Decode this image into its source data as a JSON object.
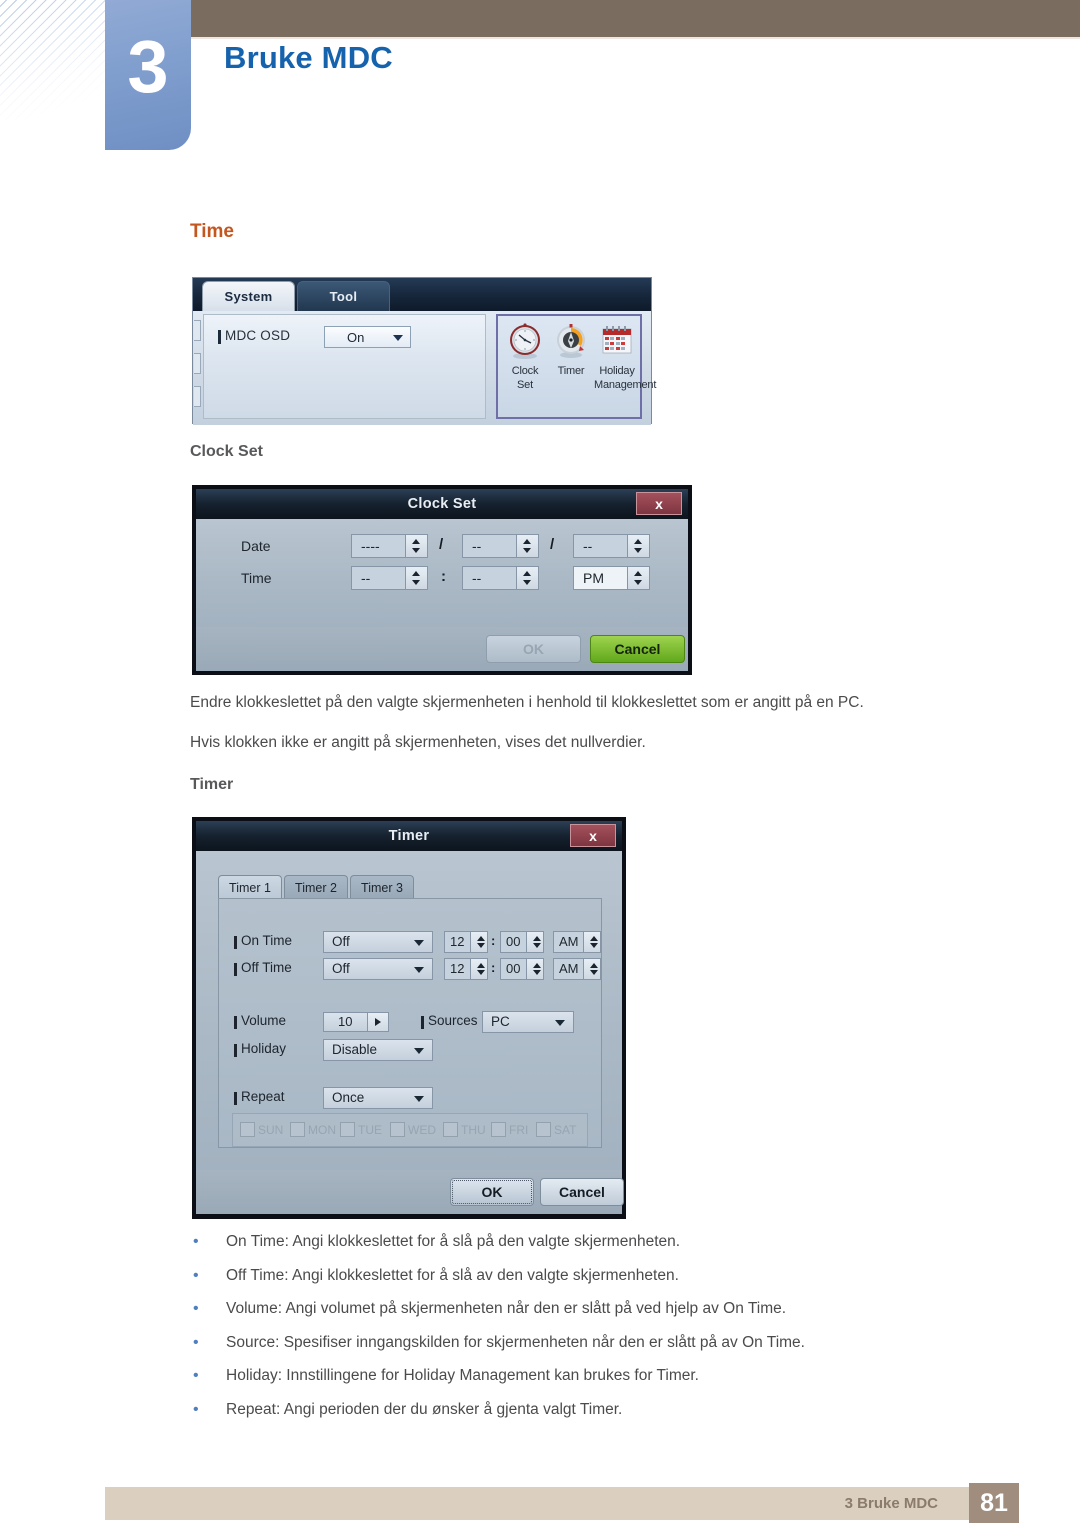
{
  "header": {
    "chapter_number": "3",
    "chapter_title": "Bruke MDC"
  },
  "sections": {
    "time_heading": "Time",
    "clock_set_heading": "Clock Set",
    "timer_heading": "Timer"
  },
  "paragraphs": {
    "p1": "Endre klokkeslettet på den valgte skjermenheten i henhold til klokkeslettet som er angitt på en PC.",
    "p2": "Hvis klokken ikke er angitt på skjermenheten, vises det nullverdier."
  },
  "bullets": [
    {
      "marker": "•",
      "text": "On Time: Angi klokkeslettet for å slå på den valgte skjermenheten."
    },
    {
      "marker": "•",
      "text": "Off Time: Angi klokkeslettet for å slå av den valgte skjermenheten."
    },
    {
      "marker": "•",
      "text": "Volume: Angi volumet på skjermenheten når den er slått på ved hjelp av On Time."
    },
    {
      "marker": "•",
      "text": "Source: Spesifiser inngangskilden for skjermenheten når den er slått på av On Time."
    },
    {
      "marker": "•",
      "text": "Holiday: Innstillingene for Holiday Management kan brukes for Timer."
    },
    {
      "marker": "•",
      "text": "Repeat: Angi perioden der du ønsker å gjenta valgt Timer."
    }
  ],
  "system_panel": {
    "tabs": [
      {
        "label": "System",
        "active": true
      },
      {
        "label": "Tool",
        "active": false
      }
    ],
    "osd_label": "MDC OSD",
    "osd_value": "On",
    "icons": [
      {
        "name": "clock-set-icon",
        "caption_line1": "Clock",
        "caption_line2": "Set"
      },
      {
        "name": "timer-icon",
        "caption_line1": "Timer",
        "caption_line2": ""
      },
      {
        "name": "holiday-management-icon",
        "caption_line1": "Holiday",
        "caption_line2": "Management"
      }
    ]
  },
  "clock_set_dialog": {
    "title": "Clock Set",
    "close_label": "x",
    "date_label": "Date",
    "time_label": "Time",
    "date_year": "----",
    "date_month": "--",
    "date_day": "--",
    "date_sep1": "/",
    "date_sep2": "/",
    "time_hour": "--",
    "time_minute": "--",
    "time_meridiem": "PM",
    "time_sep": ":",
    "ok_label": "OK",
    "cancel_label": "Cancel"
  },
  "timer_dialog": {
    "title": "Timer",
    "close_label": "x",
    "tabs": [
      {
        "label": "Timer 1",
        "active": true
      },
      {
        "label": "Timer 2",
        "active": false
      },
      {
        "label": "Timer 3",
        "active": false
      }
    ],
    "on_time": {
      "label": "On Time",
      "state": "Off",
      "hour": "12",
      "minute": "00",
      "meridiem": "AM",
      "sep": ":"
    },
    "off_time": {
      "label": "Off Time",
      "state": "Off",
      "hour": "12",
      "minute": "00",
      "meridiem": "AM",
      "sep": ":"
    },
    "volume": {
      "label": "Volume",
      "value": "10"
    },
    "sources": {
      "label": "Sources",
      "value": "PC"
    },
    "holiday": {
      "label": "Holiday",
      "value": "Disable"
    },
    "repeat": {
      "label": "Repeat",
      "value": "Once"
    },
    "days": [
      {
        "label": "SUN",
        "checked": false
      },
      {
        "label": "MON",
        "checked": false
      },
      {
        "label": "TUE",
        "checked": false
      },
      {
        "label": "WED",
        "checked": false
      },
      {
        "label": "THU",
        "checked": false
      },
      {
        "label": "FRI",
        "checked": false
      },
      {
        "label": "SAT",
        "checked": false
      }
    ],
    "ok_label": "OK",
    "cancel_label": "Cancel"
  },
  "footer": {
    "text": "3 Bruke MDC",
    "page_number": "81"
  },
  "colors": {
    "brand_blue": "#1663ad",
    "heading_orange": "#c4561f",
    "brown_bar": "#7a6d60",
    "footer_bar": "#dbcfc0",
    "footer_page_bg": "#a08d7e",
    "bullet_blue": "#4f7fbf",
    "chapter_badge": "#819fce"
  }
}
